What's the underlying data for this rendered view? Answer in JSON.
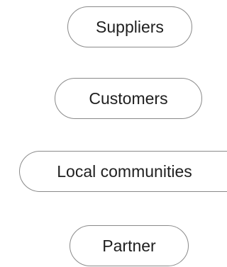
{
  "stakeholders": [
    {
      "label": "Suppliers"
    },
    {
      "label": "Customers"
    },
    {
      "label": "Local communities"
    },
    {
      "label": "Partner"
    }
  ],
  "colors": {
    "border": "#8a8a8a",
    "text": "#1f1f1f",
    "background": "#ffffff"
  }
}
